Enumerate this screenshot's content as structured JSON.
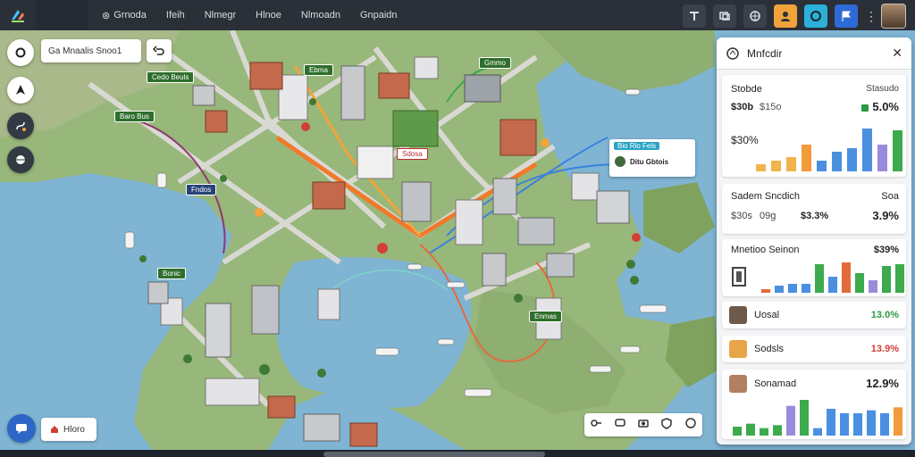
{
  "topbar": {
    "nav": [
      {
        "label": "Grnoda",
        "icon": "compass-icon"
      },
      {
        "label": "Ifeih",
        "icon": ""
      },
      {
        "label": "Nlmegr",
        "icon": ""
      },
      {
        "label": "Hlnoe",
        "icon": ""
      },
      {
        "label": "Nlmoadn",
        "icon": ""
      },
      {
        "label": "Gnpaidn",
        "icon": ""
      }
    ]
  },
  "map": {
    "search_text": "Ga Mnaalis Snoo1",
    "home_label": "Hloro",
    "labels": [
      {
        "text": "Ebma",
        "style": "green"
      },
      {
        "text": "Cedo Beuls",
        "style": "green"
      },
      {
        "text": "Baro Bus",
        "style": "green"
      },
      {
        "text": "Gmmo",
        "style": "green"
      },
      {
        "text": "Sdosa",
        "style": "red"
      },
      {
        "text": "Fndos",
        "style": "navy"
      },
      {
        "text": "Bonic",
        "style": "green"
      },
      {
        "text": "Enmas",
        "style": "green"
      }
    ],
    "poi_card": {
      "header": "Bio Rlo Fels",
      "title": "Ditu Gbtois"
    }
  },
  "panel": {
    "title": "Mnfcdir",
    "card1": {
      "title": "Stobde",
      "subtitle": "Stasudo",
      "value_left": "$30b",
      "value_left2": "$15o",
      "change": "5.0%",
      "total": "$30%",
      "bars": [
        8,
        12,
        16,
        30,
        12,
        22,
        26,
        48,
        30,
        46
      ],
      "colors": [
        "#f2b34a",
        "#f2b34a",
        "#f2b34a",
        "#f39a3a",
        "#4a8fe0",
        "#4a8fe0",
        "#4a8fe0",
        "#4a8fe0",
        "#9a8cdc",
        "#3caa4d"
      ]
    },
    "card2": {
      "title": "Sadem Sncdich",
      "suffix": "Soa",
      "v1": "$30s",
      "v2": "09g",
      "v3": "$3.3%",
      "change": "3.9%"
    },
    "card3": {
      "title": "Mnetioo Seinon",
      "change": "$39%",
      "bars": [
        4,
        8,
        10,
        10,
        32,
        18,
        34,
        22,
        14,
        30,
        32
      ],
      "colors": [
        "#e36b3b",
        "#4a8fe0",
        "#4a8fe0",
        "#4a8fe0",
        "#3caa4d",
        "#4a8fe0",
        "#e36b3b",
        "#3caa4d",
        "#9a8cdc",
        "#3caa4d",
        "#3caa4d"
      ]
    },
    "rows": [
      {
        "name": "Uosal",
        "value": "13.0%",
        "tone": "green",
        "thumb": "#6d5a4a"
      },
      {
        "name": "Sodsls",
        "value": "13.9%",
        "tone": "red",
        "thumb": "#e8a449"
      },
      {
        "name": "Sonamad",
        "value": "12.9%",
        "tone": "green",
        "thumb": "#b08060"
      }
    ],
    "card4": {
      "bars": [
        12,
        16,
        10,
        14,
        40,
        48,
        10,
        36,
        30,
        30,
        34,
        30,
        38
      ],
      "colors": [
        "#3caa4d",
        "#3caa4d",
        "#3caa4d",
        "#3caa4d",
        "#9a8cdc",
        "#3caa4d",
        "#4a8fe0",
        "#4a8fe0",
        "#4a8fe0",
        "#4a8fe0",
        "#4a8fe0",
        "#4a8fe0",
        "#f39a3a"
      ]
    }
  }
}
